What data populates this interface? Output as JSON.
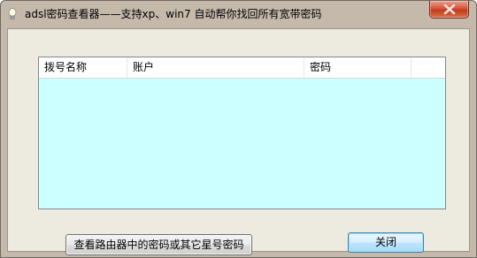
{
  "window": {
    "title": "adsl密码查看器——支持xp、win7 自动帮你找回所有宽带密码"
  },
  "icons": {
    "app": "lightbulb-icon",
    "close": "close-icon"
  },
  "listview": {
    "columns": [
      "拨号名称",
      "账户",
      "密码"
    ],
    "rows": [],
    "background": "#ccffff"
  },
  "buttons": {
    "router_label": "查看路由器中的密码或其它星号密码",
    "close_label": "关闭"
  }
}
